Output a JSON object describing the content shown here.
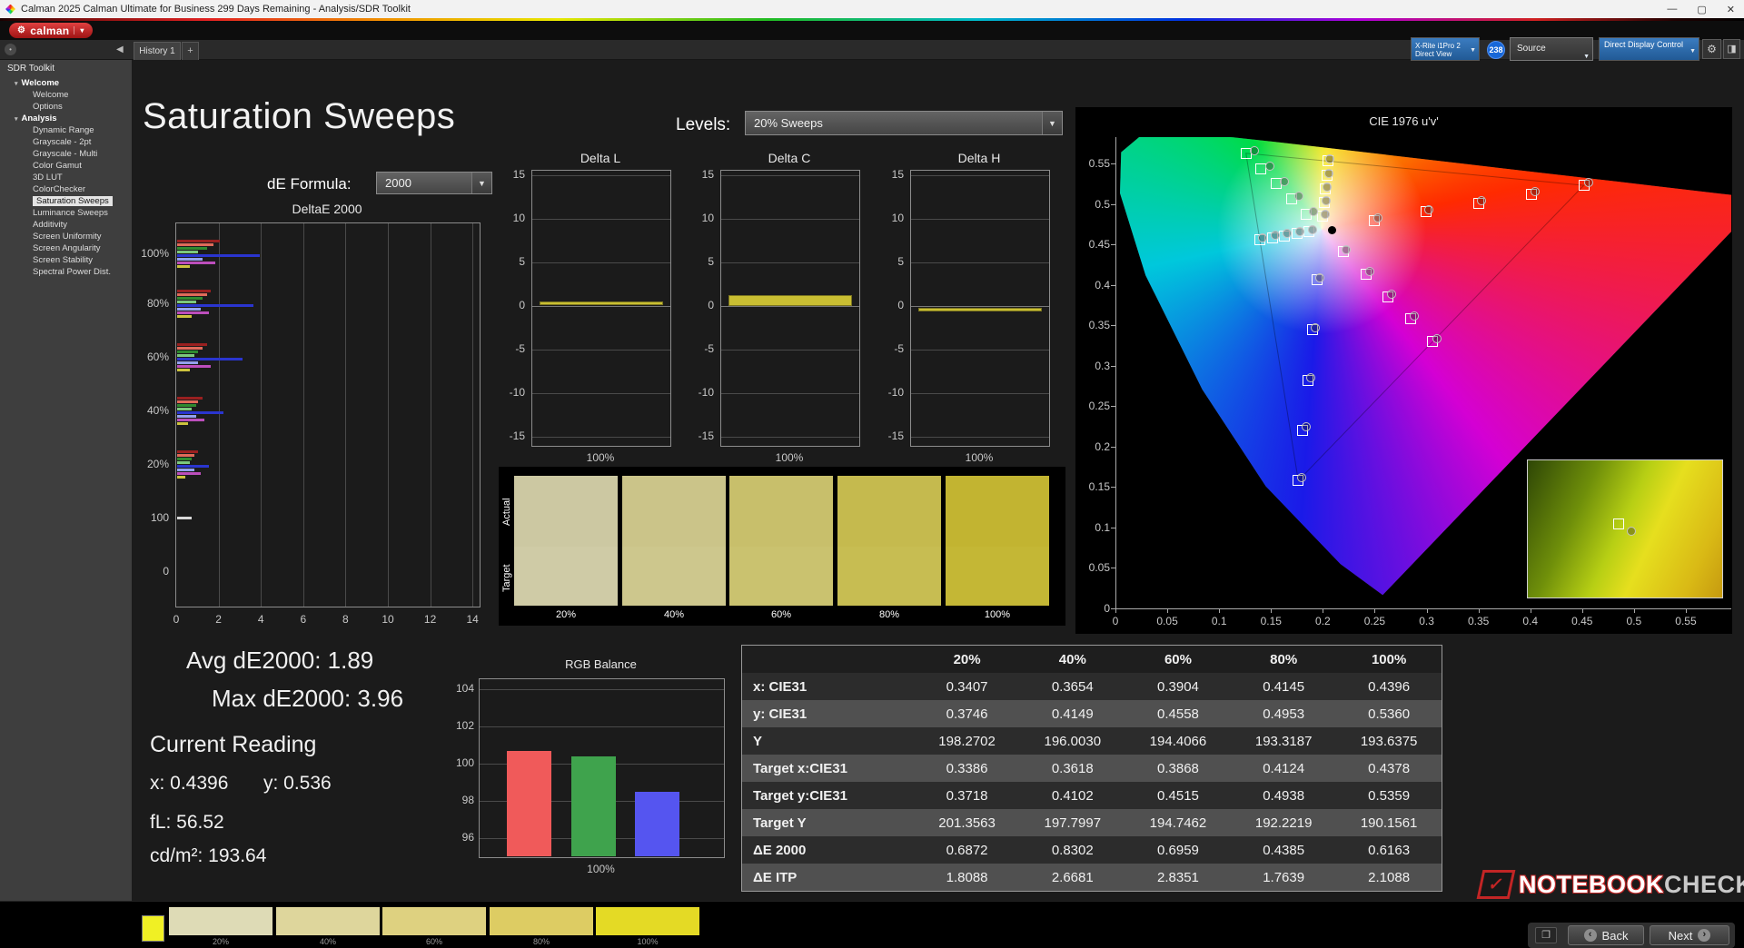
{
  "titlebar": {
    "title": "Calman 2025 Calman Ultimate for Business 299 Days Remaining - Analysis/SDR Toolkit",
    "minimize": "—",
    "maximize": "▢",
    "close": "✕"
  },
  "header": {
    "logo_text": "calman"
  },
  "tabbar": {
    "tab": "History 1",
    "add": "+"
  },
  "toolbar": {
    "meter_line1": "X-Rite i1Pro 2",
    "meter_line2": "Direct View",
    "badge": "238",
    "source": "Source",
    "display_control": "Direct Display Control"
  },
  "sidebar": {
    "header": "SDR Toolkit",
    "tree": [
      {
        "label": "Welcome",
        "type": "group"
      },
      {
        "label": "Welcome",
        "type": "item"
      },
      {
        "label": "Options",
        "type": "item"
      },
      {
        "label": "Analysis",
        "type": "group"
      },
      {
        "label": "Dynamic Range",
        "type": "item"
      },
      {
        "label": "Grayscale - 2pt",
        "type": "item"
      },
      {
        "label": "Grayscale - Multi",
        "type": "item"
      },
      {
        "label": "Color Gamut",
        "type": "item"
      },
      {
        "label": "3D LUT",
        "type": "item"
      },
      {
        "label": "ColorChecker",
        "type": "item"
      },
      {
        "label": "Saturation Sweeps",
        "type": "item",
        "selected": true
      },
      {
        "label": "Luminance Sweeps",
        "type": "item"
      },
      {
        "label": "Additivity",
        "type": "item"
      },
      {
        "label": "Screen Uniformity",
        "type": "item"
      },
      {
        "label": "Screen Angularity",
        "type": "item"
      },
      {
        "label": "Screen Stability",
        "type": "item"
      },
      {
        "label": "Spectral Power Dist.",
        "type": "item"
      }
    ]
  },
  "main": {
    "title": "Saturation Sweeps",
    "levels_label": "Levels:",
    "levels_value": "20% Sweeps",
    "de_formula_label": "dE Formula:",
    "de_formula_value": "2000"
  },
  "stats": {
    "avg": "Avg dE2000: 1.89",
    "max": "Max dE2000: 3.96",
    "current_title": "Current Reading",
    "x": "x: 0.4396",
    "y": "y: 0.536",
    "fl": "fL: 56.52",
    "cd": "cd/m²: 193.64"
  },
  "swatches": {
    "actual_label": "Actual",
    "target_label": "Target",
    "levels": [
      "20%",
      "40%",
      "60%",
      "80%",
      "100%"
    ],
    "actual_colors": [
      "#ccc8a2",
      "#cbc489",
      "#c8bf6b",
      "#c5ba4e",
      "#c2b431"
    ],
    "target_colors": [
      "#cfcba6",
      "#cdc78d",
      "#cac26f",
      "#c7bd52",
      "#c4b735"
    ]
  },
  "table": {
    "columns": [
      "20%",
      "40%",
      "60%",
      "80%",
      "100%"
    ],
    "rows": [
      {
        "label": "x: CIE31",
        "values": [
          "0.3407",
          "0.3654",
          "0.3904",
          "0.4145",
          "0.4396"
        ]
      },
      {
        "label": "y: CIE31",
        "values": [
          "0.3746",
          "0.4149",
          "0.4558",
          "0.4953",
          "0.5360"
        ]
      },
      {
        "label": "Y",
        "values": [
          "198.2702",
          "196.0030",
          "194.4066",
          "193.3187",
          "193.6375"
        ]
      },
      {
        "label": "Target x:CIE31",
        "values": [
          "0.3386",
          "0.3618",
          "0.3868",
          "0.4124",
          "0.4378"
        ]
      },
      {
        "label": "Target y:CIE31",
        "values": [
          "0.3718",
          "0.4102",
          "0.4515",
          "0.4938",
          "0.5359"
        ]
      },
      {
        "label": "Target Y",
        "values": [
          "201.3563",
          "197.7997",
          "194.7462",
          "192.2219",
          "190.1561"
        ]
      },
      {
        "label": "ΔE 2000",
        "values": [
          "0.6872",
          "0.8302",
          "0.6959",
          "0.4385",
          "0.6163"
        ]
      },
      {
        "label": "ΔE ITP",
        "values": [
          "1.8088",
          "2.6681",
          "2.8351",
          "1.7639",
          "2.1088"
        ]
      }
    ]
  },
  "bottom": {
    "current_color": "#f0f024",
    "patches": [
      {
        "label": "20%",
        "color": "#dedbb6"
      },
      {
        "label": "40%",
        "color": "#ded69c"
      },
      {
        "label": "60%",
        "color": "#ded180"
      },
      {
        "label": "80%",
        "color": "#ddcc63"
      },
      {
        "label": "100%",
        "color": "#e4da25"
      }
    ]
  },
  "watermark": {
    "red": "NOTEBOOK",
    "grey": "CHECK"
  },
  "nav": {
    "back": "Back",
    "next": "Next"
  },
  "chart_data": {
    "deltae": {
      "type": "bar",
      "title": "DeltaE 2000",
      "xticks": [
        0,
        2,
        4,
        6,
        8,
        10,
        12,
        14
      ],
      "xmax": 14.3,
      "row_labels": [
        "100%",
        "80%",
        "60%",
        "40%",
        "20%",
        "100",
        "0"
      ],
      "clusters": [
        {
          "label": "100%",
          "bars": [
            [
              "#9a2020",
              2.0
            ],
            [
              "#e06a5a",
              1.7
            ],
            [
              "#2f8a2f",
              1.4
            ],
            [
              "#7cc87c",
              1.0
            ],
            [
              "#2a35cf",
              3.9
            ],
            [
              "#93a0ee",
              1.2
            ],
            [
              "#bc4ebc",
              1.8
            ],
            [
              "#cdc33e",
              0.6
            ]
          ]
        },
        {
          "label": "80%",
          "bars": [
            [
              "#9a2020",
              1.6
            ],
            [
              "#e06a5a",
              1.4
            ],
            [
              "#2f8a2f",
              1.2
            ],
            [
              "#7cc87c",
              0.9
            ],
            [
              "#2a35cf",
              3.6
            ],
            [
              "#93a0ee",
              1.1
            ],
            [
              "#bc4ebc",
              1.5
            ],
            [
              "#cdc33e",
              0.7
            ]
          ]
        },
        {
          "label": "60%",
          "bars": [
            [
              "#9a2020",
              1.4
            ],
            [
              "#e06a5a",
              1.2
            ],
            [
              "#2f8a2f",
              1.0
            ],
            [
              "#7cc87c",
              0.8
            ],
            [
              "#2a35cf",
              3.1
            ],
            [
              "#93a0ee",
              1.0
            ],
            [
              "#bc4ebc",
              1.6
            ],
            [
              "#cdc33e",
              0.6
            ]
          ]
        },
        {
          "label": "40%",
          "bars": [
            [
              "#9a2020",
              1.2
            ],
            [
              "#e06a5a",
              1.0
            ],
            [
              "#2f8a2f",
              0.9
            ],
            [
              "#7cc87c",
              0.7
            ],
            [
              "#2a35cf",
              2.2
            ],
            [
              "#93a0ee",
              0.9
            ],
            [
              "#bc4ebc",
              1.3
            ],
            [
              "#cdc33e",
              0.5
            ]
          ]
        },
        {
          "label": "20%",
          "bars": [
            [
              "#9a2020",
              1.0
            ],
            [
              "#e06a5a",
              0.8
            ],
            [
              "#2f8a2f",
              0.7
            ],
            [
              "#7cc87c",
              0.6
            ],
            [
              "#2a35cf",
              1.5
            ],
            [
              "#93a0ee",
              0.8
            ],
            [
              "#bc4ebc",
              1.1
            ],
            [
              "#cdc33e",
              0.4
            ]
          ]
        },
        {
          "label": "100",
          "bars": [
            [
              "#d8d8d8",
              0.7
            ]
          ]
        }
      ]
    },
    "delta_l": {
      "type": "bar",
      "title": "Delta L",
      "yticks": [
        15,
        10,
        5,
        0,
        -5,
        -10,
        -15
      ],
      "ylim": [
        -15.5,
        15.5
      ],
      "xlabel": "100%",
      "value": 0.3,
      "style": "line",
      "color": "#c9be32"
    },
    "delta_c": {
      "type": "bar",
      "title": "Delta C",
      "yticks": [
        15,
        10,
        5,
        0,
        -5,
        -10,
        -15
      ],
      "ylim": [
        -15.5,
        15.5
      ],
      "xlabel": "100%",
      "value": 1.2,
      "style": "bar",
      "color": "#c9be32"
    },
    "delta_h": {
      "type": "bar",
      "title": "Delta H",
      "yticks": [
        15,
        10,
        5,
        0,
        -5,
        -10,
        -15
      ],
      "ylim": [
        -15.5,
        15.5
      ],
      "xlabel": "100%",
      "value": -0.4,
      "style": "line",
      "color": "#c9be32"
    },
    "rgb": {
      "type": "bar",
      "title": "RGB Balance",
      "yticks": [
        104,
        102,
        100,
        98,
        96
      ],
      "ylim": [
        95,
        104.6
      ],
      "xlabel": "100%",
      "series": [
        {
          "name": "Red",
          "color": "#f05a5a",
          "value": 100.7
        },
        {
          "name": "Green",
          "color": "#3fa34d",
          "value": 100.4
        },
        {
          "name": "Blue",
          "color": "#5555f0",
          "value": 98.5
        }
      ]
    },
    "cie": {
      "type": "scatter",
      "title": "CIE 1976 u'v'",
      "xticks": [
        "0",
        "0.05",
        "0.1",
        "0.15",
        "0.2",
        "0.25",
        "0.3",
        "0.35",
        "0.4",
        "0.45",
        "0.5",
        "0.55"
      ],
      "yticks": [
        "0.55",
        "0.5",
        "0.45",
        "0.4",
        "0.35",
        "0.3",
        "0.25",
        "0.2",
        "0.15",
        "0.1",
        "0.05",
        "0"
      ],
      "locus": [
        [
          0.2568,
          0.0165
        ],
        [
          0.2161,
          0.0549
        ],
        [
          0.1441,
          0.151
        ],
        [
          0.0828,
          0.2708
        ],
        [
          0.0282,
          0.4117
        ],
        [
          0.0035,
          0.5131
        ],
        [
          0.0046,
          0.5639
        ],
        [
          0.0231,
          0.5837
        ],
        [
          0.0501,
          0.5868
        ],
        [
          0.0792,
          0.5856
        ],
        [
          0.1127,
          0.5821
        ],
        [
          0.1531,
          0.5766
        ],
        [
          0.2026,
          0.5694
        ],
        [
          0.2623,
          0.5604
        ],
        [
          0.3315,
          0.5501
        ],
        [
          0.4035,
          0.5393
        ],
        [
          0.4692,
          0.5296
        ],
        [
          0.5203,
          0.5219
        ],
        [
          0.583,
          0.5125
        ],
        [
          0.6109,
          0.5084
        ],
        [
          0.6234,
          0.5065
        ]
      ],
      "triangle": [
        [
          0.4507,
          0.5229
        ],
        [
          0.125,
          0.5625
        ],
        [
          0.1754,
          0.1579
        ]
      ],
      "squares": [
        [
          0.2484,
          0.4792
        ],
        [
          0.299,
          0.4901
        ],
        [
          0.3495,
          0.501
        ],
        [
          0.4001,
          0.512
        ],
        [
          0.4507,
          0.5229
        ],
        [
          0.1832,
          0.4871
        ],
        [
          0.1687,
          0.506
        ],
        [
          0.1541,
          0.5248
        ],
        [
          0.1396,
          0.5437
        ],
        [
          0.125,
          0.5625
        ],
        [
          0.1933,
          0.4062
        ],
        [
          0.1888,
          0.3441
        ],
        [
          0.1844,
          0.2821
        ],
        [
          0.1799,
          0.22
        ],
        [
          0.1754,
          0.1579
        ],
        [
          0.1859,
          0.4657
        ],
        [
          0.174,
          0.4632
        ],
        [
          0.1622,
          0.4606
        ],
        [
          0.1503,
          0.4581
        ],
        [
          0.1384,
          0.4555
        ],
        [
          0.2192,
          0.4406
        ],
        [
          0.2407,
          0.4129
        ],
        [
          0.2621,
          0.3852
        ],
        [
          0.2836,
          0.3575
        ],
        [
          0.305,
          0.3298
        ],
        [
          0.1991,
          0.4852
        ],
        [
          0.2003,
          0.5021
        ],
        [
          0.2016,
          0.519
        ],
        [
          0.2028,
          0.5359
        ],
        [
          0.2041,
          0.5528
        ]
      ],
      "circles": [
        [
          0.252,
          0.483
        ],
        [
          0.301,
          0.493
        ],
        [
          0.352,
          0.504
        ],
        [
          0.404,
          0.515
        ],
        [
          0.455,
          0.526
        ],
        [
          0.19,
          0.49
        ],
        [
          0.176,
          0.509
        ],
        [
          0.162,
          0.528
        ],
        [
          0.148,
          0.547
        ],
        [
          0.133,
          0.566
        ],
        [
          0.196,
          0.409
        ],
        [
          0.192,
          0.347
        ],
        [
          0.187,
          0.285
        ],
        [
          0.183,
          0.224
        ],
        [
          0.179,
          0.162
        ],
        [
          0.189,
          0.468
        ],
        [
          0.177,
          0.466
        ],
        [
          0.165,
          0.463
        ],
        [
          0.153,
          0.461
        ],
        [
          0.141,
          0.458
        ],
        [
          0.222,
          0.443
        ],
        [
          0.244,
          0.416
        ],
        [
          0.265,
          0.388
        ],
        [
          0.287,
          0.361
        ],
        [
          0.309,
          0.333
        ],
        [
          0.201,
          0.487
        ],
        [
          0.202,
          0.504
        ],
        [
          0.203,
          0.521
        ],
        [
          0.205,
          0.538
        ],
        [
          0.206,
          0.556
        ]
      ],
      "dot": [
        0.2079,
        0.4675
      ]
    }
  }
}
